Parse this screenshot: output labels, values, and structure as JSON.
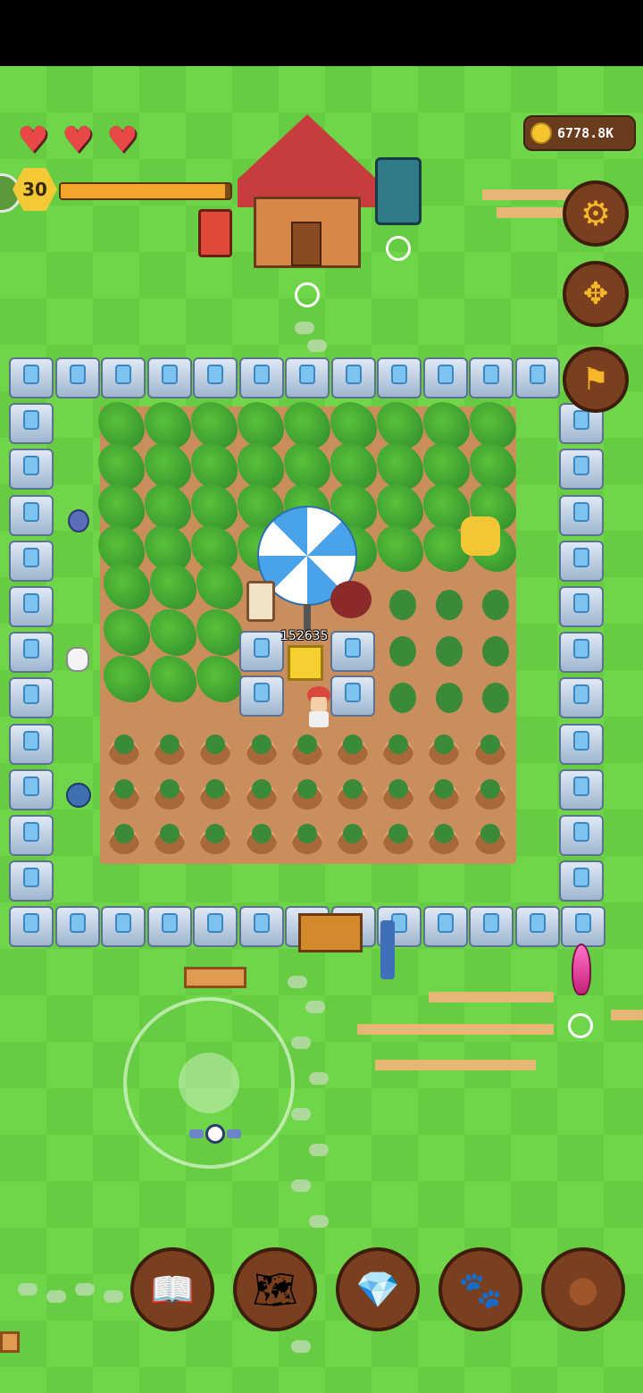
{
  "hud": {
    "hearts": [
      "♥",
      "♥",
      "♥"
    ],
    "level": "30",
    "level_progress": 0.97,
    "coins": "6778.8K"
  },
  "side_buttons": {
    "settings_icon": "gear-icon",
    "move_icon": "move-arrows-icon",
    "flag_icon": "flag-icon"
  },
  "farm": {
    "umbrella_label": "152635"
  },
  "bottom_bar": {
    "items": [
      {
        "icon": "book-icon",
        "glyph": "📖"
      },
      {
        "icon": "map-scroll-icon",
        "glyph": "🗺"
      },
      {
        "icon": "gem-coin-icon",
        "glyph": "💎"
      },
      {
        "icon": "paw-icon",
        "glyph": "🐾"
      },
      {
        "icon": "leather-bag-icon",
        "glyph": "●"
      }
    ]
  },
  "colors": {
    "grass": "#6fd64a",
    "soil": "#c98e5c",
    "accent_button": "#7a3f1f",
    "heart": "#e84848",
    "coin": "#f5c431"
  }
}
